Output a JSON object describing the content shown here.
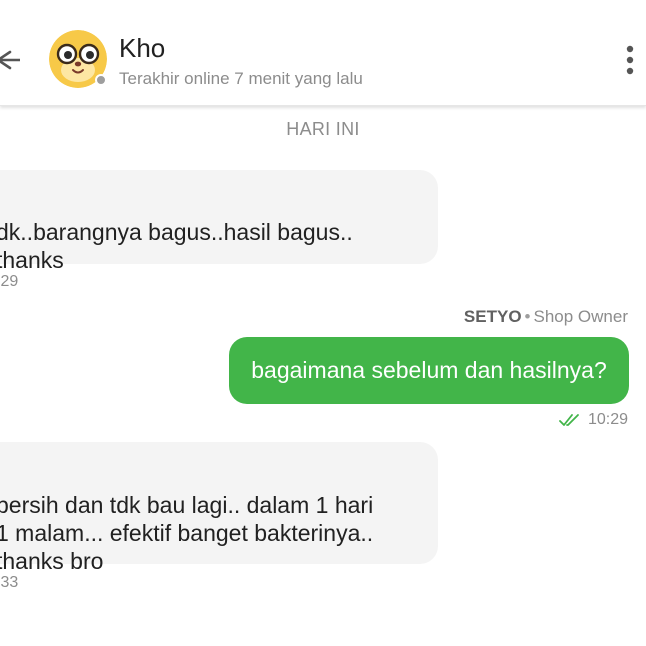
{
  "header": {
    "contact_name": "Kho",
    "last_seen": "Terakhir online 7 menit yang lalu",
    "back_icon": "arrow-left-icon",
    "menu_icon": "more-vertical-icon",
    "status_color": "#9e9e9e"
  },
  "chat": {
    "date_label": "HARI INI",
    "messages": [
      {
        "direction": "incoming",
        "text": "dk..barangnya bagus..hasil bagus..\nthanks",
        "time": ":29"
      },
      {
        "direction": "outgoing",
        "sender_name": "SETYO",
        "sender_role": "Shop Owner",
        "text": "bagaimana sebelum dan hasilnya?",
        "time": "10:29",
        "status_icon": "double-check-icon"
      },
      {
        "direction": "incoming",
        "text": "bersih dan tdk bau lagi.. dalam 1 hari\n1 malam... efektif banget bakterinya..\nthanks bro",
        "time": ":33"
      }
    ]
  },
  "colors": {
    "outgoing_bubble": "#42b549",
    "incoming_bubble": "#f4f4f4",
    "read_check": "#42b549",
    "muted_text": "#8c8c8c"
  }
}
